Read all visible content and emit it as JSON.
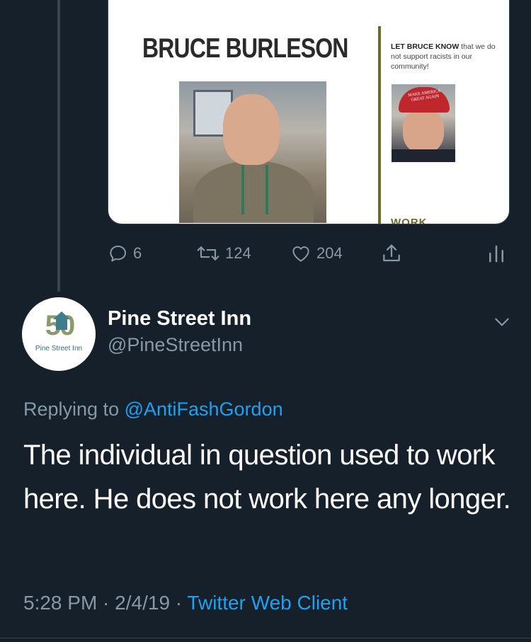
{
  "embedded_media": {
    "poster_name": "BRUCE BURLESON",
    "side_text_bold": "LET BRUCE KNOW",
    "side_text_rest": "that we do not support racists in our community!",
    "hat_text": "MAKE AMERICA GREAT AGAIN",
    "cut_off_text": "WORK"
  },
  "parent_actions": {
    "reply_count": "6",
    "retweet_count": "124",
    "like_count": "204"
  },
  "reply_tweet": {
    "avatar_logo_number": "50",
    "avatar_logo_text": "Pine Street Inn",
    "display_name": "Pine Street Inn",
    "handle": "@PineStreetInn",
    "replying_prefix": "Replying to ",
    "replying_mention": "@AntiFashGordon",
    "text": "The individual in question used to work here. He does not work here any longer.",
    "time": "5:28 PM",
    "date": "2/4/19",
    "separator": " · ",
    "client": "Twitter Web Client"
  },
  "colors": {
    "background": "#15202b",
    "secondary_text": "#8899a6",
    "accent": "#1da1f2",
    "divider": "#38444d"
  }
}
